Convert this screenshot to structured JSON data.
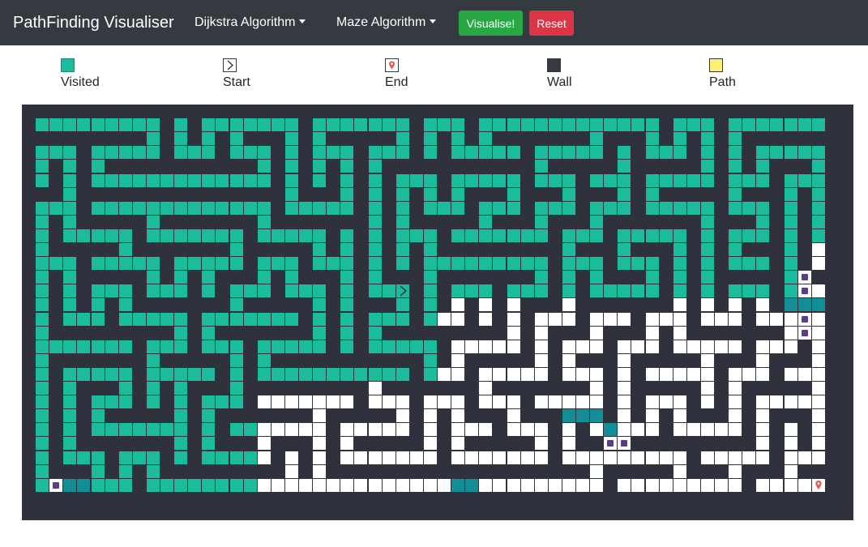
{
  "app": {
    "title": "PathFinding Visualiser"
  },
  "navbar": {
    "algorithm_label": "Dijkstra Algorithm",
    "maze_label": "Maze Algorithm",
    "visualise_label": "Visualise!",
    "reset_label": "Reset"
  },
  "legend": [
    {
      "key": "visited",
      "label": "Visited",
      "icon": "visited-swatch",
      "color": "#1abc9c"
    },
    {
      "key": "start",
      "label": "Start",
      "icon": "chevron-right-icon"
    },
    {
      "key": "end",
      "label": "End",
      "icon": "map-pin-icon",
      "color": "#e05a5a"
    },
    {
      "key": "wall",
      "label": "Wall",
      "icon": "wall-swatch",
      "color": "#343a40"
    },
    {
      "key": "path",
      "label": "Path",
      "icon": "path-swatch",
      "color": "#fff176"
    }
  ],
  "colors": {
    "navbar": "#343a40",
    "visualise_button": "#28a745",
    "reset_button": "#dc3545",
    "wall": "#2f323d",
    "visited": "#1abc9c",
    "frontier": "#138d96",
    "queued": "#5a3d8a",
    "end_marker": "#e05a5a"
  },
  "grid": {
    "rows": 29,
    "cols": 60
  }
}
